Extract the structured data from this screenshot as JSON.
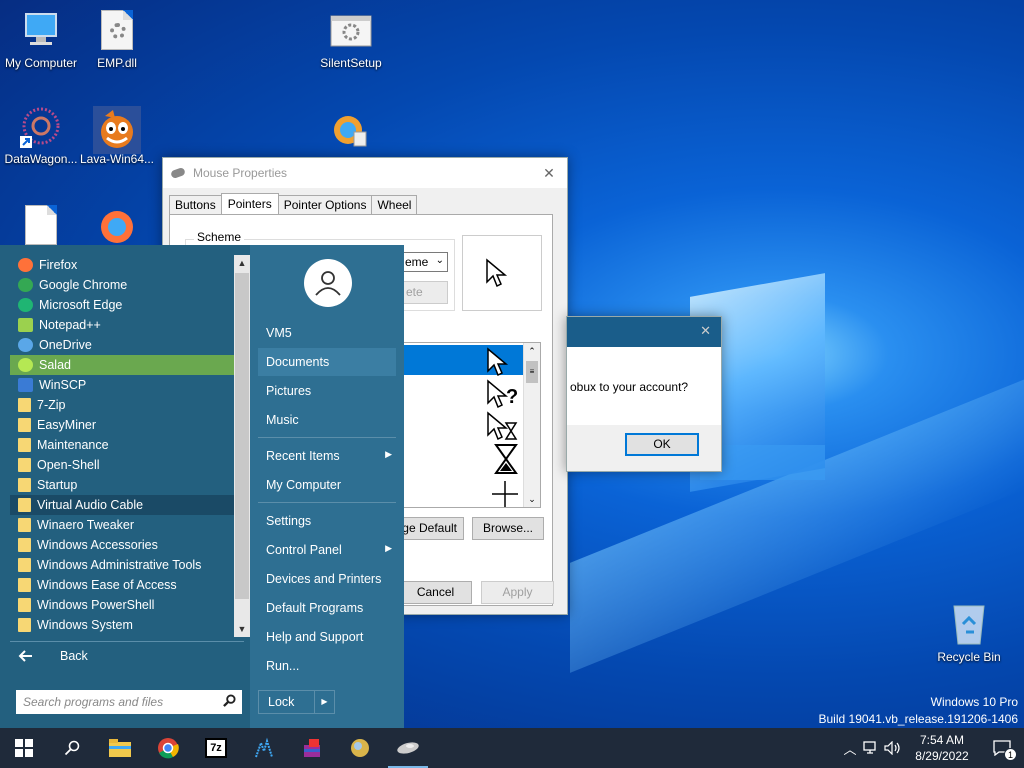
{
  "desktop": {
    "icons": [
      {
        "label": "My Computer"
      },
      {
        "label": "EMP.dll"
      },
      {
        "label": "SilentSetup"
      },
      {
        "label": "DataWagon..."
      },
      {
        "label": "Lava-Win64..."
      },
      {
        "label": "Recycle Bin"
      }
    ],
    "watermark": {
      "line1": "Windows 10 Pro",
      "line2": "Build 19041.vb_release.191206-1406"
    }
  },
  "mouse_properties": {
    "title": "Mouse Properties",
    "tabs": [
      "Buttons",
      "Pointers",
      "Pointer Options",
      "Wheel"
    ],
    "active_tab": "Pointers",
    "scheme_label": "Scheme",
    "scheme_value": "eme",
    "delete_label": "ete",
    "use_default_label": "ge Default",
    "browse_label": "Browse...",
    "cancel_label": "Cancel",
    "apply_label": "Apply"
  },
  "dialog2": {
    "message": "obux to your account?",
    "ok_label": "OK"
  },
  "start_menu": {
    "programs": [
      {
        "label": "Firefox",
        "icon": "firefox-icon",
        "color": "#ff7139"
      },
      {
        "label": "Google Chrome",
        "icon": "chrome-icon",
        "color": "#34a853"
      },
      {
        "label": "Microsoft Edge",
        "icon": "edge-icon",
        "color": "#1fb573"
      },
      {
        "label": "Notepad++",
        "icon": "notepadpp-icon",
        "color": "#9bd14e"
      },
      {
        "label": "OneDrive",
        "icon": "onedrive-icon",
        "color": "#5aa7e8"
      },
      {
        "label": "Salad",
        "icon": "salad-icon",
        "color": "#b5e853"
      },
      {
        "label": "WinSCP",
        "icon": "winscp-icon",
        "color": "#3a7bd5"
      },
      {
        "label": "7-Zip",
        "icon": "folder-icon"
      },
      {
        "label": "EasyMiner",
        "icon": "folder-icon"
      },
      {
        "label": "Maintenance",
        "icon": "folder-icon"
      },
      {
        "label": "Open-Shell",
        "icon": "folder-icon"
      },
      {
        "label": "Startup",
        "icon": "folder-icon"
      },
      {
        "label": "Virtual Audio Cable",
        "icon": "folder-icon"
      },
      {
        "label": "Winaero Tweaker",
        "icon": "folder-icon"
      },
      {
        "label": "Windows Accessories",
        "icon": "folder-icon"
      },
      {
        "label": "Windows Administrative Tools",
        "icon": "folder-icon"
      },
      {
        "label": "Windows Ease of Access",
        "icon": "folder-icon"
      },
      {
        "label": "Windows PowerShell",
        "icon": "folder-icon"
      },
      {
        "label": "Windows System",
        "icon": "folder-icon"
      }
    ],
    "back_label": "Back",
    "search_placeholder": "Search programs and files",
    "user": "VM5",
    "places": [
      "Documents",
      "Pictures",
      "Music"
    ],
    "recent_items": "Recent Items",
    "my_computer": "My Computer",
    "settings": "Settings",
    "control_panel": "Control Panel",
    "devices_printers": "Devices and Printers",
    "default_programs": "Default Programs",
    "help_support": "Help and Support",
    "run": "Run...",
    "lock": "Lock"
  },
  "taskbar": {
    "time": "7:54 AM",
    "date": "8/29/2022",
    "notification_count": "1",
    "zip_label": "7z"
  }
}
